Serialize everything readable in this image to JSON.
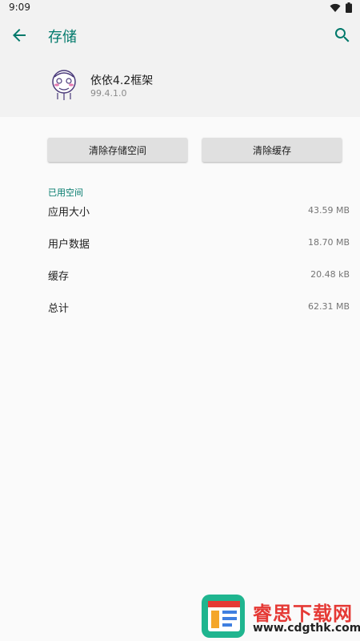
{
  "status_bar": {
    "time": "9:09"
  },
  "toolbar": {
    "title": "存储"
  },
  "app": {
    "name": "依依4.2框架",
    "version": "99.4.1.0"
  },
  "buttons": {
    "clear_storage": "清除存储空间",
    "clear_cache": "清除缓存"
  },
  "usage": {
    "section_title": "已用空间",
    "rows": [
      {
        "label": "应用大小",
        "value": "43.59 MB"
      },
      {
        "label": "用户数据",
        "value": "18.70 MB"
      },
      {
        "label": "缓存",
        "value": "20.48 kB"
      },
      {
        "label": "总计",
        "value": "62.31 MB"
      }
    ]
  },
  "watermark": {
    "title": "睿思下载网",
    "url": "www.cdgthk.com"
  },
  "colors": {
    "accent": "#00796b",
    "header_bg": "#f2f2f2",
    "button_bg": "#e0e0e0"
  }
}
